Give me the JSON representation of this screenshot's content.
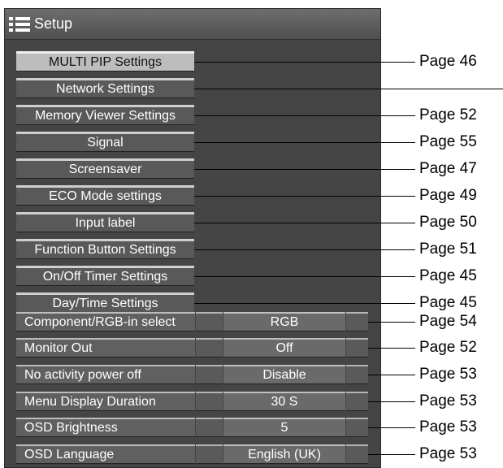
{
  "window": {
    "title": "Setup",
    "icon": "menu-list-icon"
  },
  "menu_items": [
    {
      "label": "MULTI PIP Settings",
      "page": "Page 46",
      "selected": true
    },
    {
      "label": "Network Settings",
      "page": ""
    },
    {
      "label": "Memory Viewer Settings",
      "page": "Page 52"
    },
    {
      "label": "Signal",
      "page": "Page 55"
    },
    {
      "label": "Screensaver",
      "page": "Page 47"
    },
    {
      "label": "ECO Mode settings",
      "page": "Page 49"
    },
    {
      "label": "Input label",
      "page": "Page 50"
    },
    {
      "label": "Function Button Settings",
      "page": "Page 51"
    },
    {
      "label": "On/Off Timer Settings",
      "page": "Page 45"
    },
    {
      "label": "Day/Time Settings",
      "page": "Page 45"
    }
  ],
  "settings_rows": [
    {
      "label": "Component/RGB-in select",
      "value": "RGB",
      "page": "Page 54"
    },
    {
      "label": "Monitor Out",
      "value": "Off",
      "page": "Page 52"
    },
    {
      "label": "No activity power off",
      "value": "Disable",
      "page": "Page 53"
    },
    {
      "label": "Menu Display Duration",
      "value": "30 S",
      "page": "Page 53"
    },
    {
      "label": "OSD Brightness",
      "value": "5",
      "page": "Page 53"
    },
    {
      "label": "OSD Language",
      "value": "English (UK)",
      "page": "Page 53"
    }
  ],
  "colors": {
    "panel": "#454545",
    "selected": "#bdbdbd",
    "text": "#ffffff"
  }
}
